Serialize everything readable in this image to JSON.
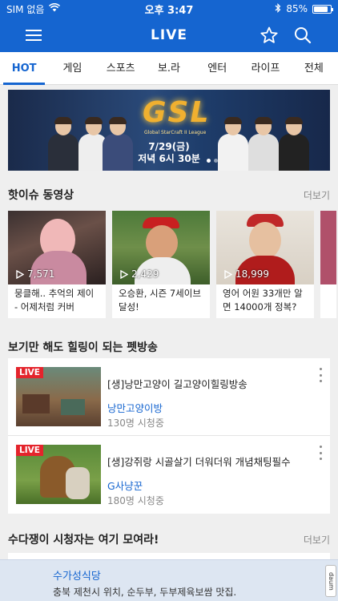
{
  "status_bar": {
    "carrier": "SIM 없음",
    "time": "오후 3:47",
    "battery": "85%",
    "battery_level": 0.85
  },
  "app_bar": {
    "title": "LIVE",
    "icons": [
      "menu-icon",
      "star-icon",
      "search-icon"
    ]
  },
  "tabs": [
    {
      "label": "HOT",
      "active": true
    },
    {
      "label": "게임",
      "active": false
    },
    {
      "label": "스포츠",
      "active": false
    },
    {
      "label": "보.라",
      "active": false
    },
    {
      "label": "엔터",
      "active": false
    },
    {
      "label": "라이프",
      "active": false
    },
    {
      "label": "전체",
      "active": false
    }
  ],
  "banner": {
    "logo": "GSL",
    "logo_sub": "Global StarCraft II League",
    "date": "7/29(금)",
    "time": "저녁 6시 30분"
  },
  "hot_issue": {
    "title": "핫이슈 동영상",
    "more": "더보기",
    "videos": [
      {
        "count": "7,571",
        "title": "뭉클해.. 추억의 제이 - 어제처럼 커버"
      },
      {
        "count": "2,429",
        "title": "오승환, 시즌 7세이브 달성!"
      },
      {
        "count": "18,999",
        "title": "영어 어원 33개만 알면 14000개 정복?"
      }
    ]
  },
  "pet_section": {
    "title": "보기만 해도 힐링이 되는 펫방송",
    "items": [
      {
        "badge": "LIVE",
        "title": "[생]낭만고양이 길고양이힐링방송",
        "channel": "낭만고양이방",
        "viewers": "130명 시청중"
      },
      {
        "badge": "LIVE",
        "title": "[생]강쥐랑 시골살기 더워더워 개념채팅필수",
        "channel": "G사냥꾼",
        "viewers": "180명 시청중"
      }
    ]
  },
  "chat_section": {
    "title": "수다쟁이 시청자는 여기 모여라!",
    "more": "더보기"
  },
  "ad": {
    "title": "수가성식당",
    "desc": "충북 제천시 위치, 순두부, 두부제육보쌈 맛집.",
    "mark": "daum"
  },
  "colors": {
    "primary": "#1565d0",
    "live": "#e4242c",
    "background": "#efefef"
  }
}
